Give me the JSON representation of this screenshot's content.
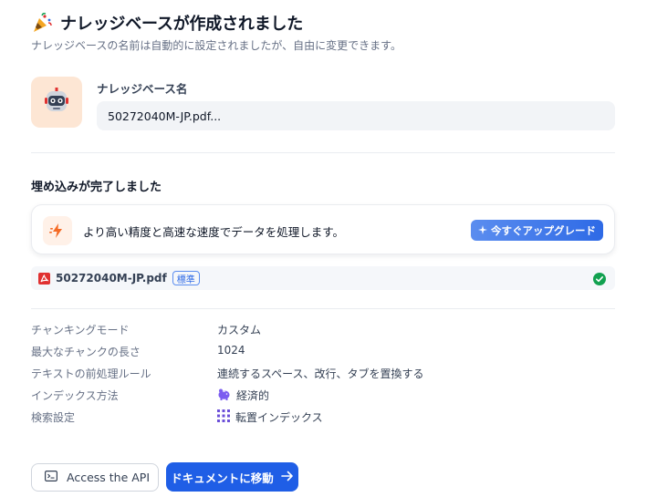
{
  "header": {
    "title": "ナレッジベースが作成されました",
    "subtitle": "ナレッジベースの名前は自動的に設定されましたが、自由に変更できます。",
    "icon": "party-popper-icon"
  },
  "knowledge_base": {
    "label": "ナレッジベース名",
    "name_value": "50272040M-JP.pdf...",
    "avatar_icon": "robot-icon"
  },
  "embedding": {
    "section_title": "埋め込みが完了しました",
    "upgrade_text": "より高い精度と高速な速度でデータを処理します。",
    "upgrade_button": "今すぐアップグレード",
    "file": {
      "name": "50272040M-JP.pdf",
      "badge": "標準",
      "status": "complete"
    }
  },
  "properties": [
    {
      "key": "チャンキングモード",
      "value": "カスタム",
      "icon": ""
    },
    {
      "key": "最大なチャンクの長さ",
      "value": "1024",
      "icon": ""
    },
    {
      "key": "テキストの前処理ルール",
      "value": "連続するスペース、改行、タブを置換する",
      "icon": ""
    },
    {
      "key": "インデックス方法",
      "value": "経済的",
      "icon": "piggy-bank-icon"
    },
    {
      "key": "検索設定",
      "value": "転置インデックス",
      "icon": "grid-icon"
    }
  ],
  "actions": {
    "api_button": "Access the API",
    "go_button": "ドキュメントに移動"
  },
  "colors": {
    "primary": "#1f5ee6",
    "upgrade_gradient_start": "#5b8def",
    "avatar_bg": "#fde6d4",
    "success": "#12a150",
    "pdf_red": "#e03131"
  }
}
